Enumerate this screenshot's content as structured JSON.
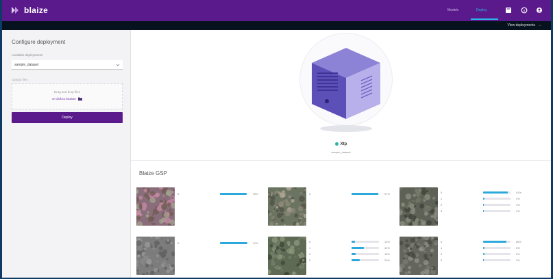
{
  "header": {
    "app_name": "blaize",
    "nav": [
      "Models",
      "Deploy"
    ],
    "active_nav": "Deploy",
    "icons": [
      "grid-icon",
      "info-icon",
      "account-icon"
    ],
    "brand_color": "#5a1a8c",
    "accent_color": "#29b6e8"
  },
  "subbar": {
    "view_deployments": "View deployments",
    "arrow": "→"
  },
  "sidebar": {
    "title": "Configure deployment",
    "select_label": "Available deployments",
    "select_value": "sample_dataset",
    "upload_label": "Upload files",
    "drop_text": "Drag and drop files",
    "drop_link": "or click to browse",
    "deploy_button": "Deploy"
  },
  "device": {
    "name": "Xtp",
    "subtitle": "sample_dataset",
    "status_color": "#28b4a0"
  },
  "results": {
    "section_title": "Blaize GSP",
    "items": [
      {
        "index": "0",
        "bars": [
          {
            "value": 0.98,
            "label": "98%"
          }
        ]
      },
      {
        "index": "0",
        "bars": [
          {
            "value": 0.97,
            "label": "97%"
          }
        ]
      },
      {
        "index": "0",
        "bars": [
          {
            "value": 0.91,
            "label": "91%"
          },
          {
            "value": 0.04,
            "label": "4%"
          },
          {
            "value": 0.03,
            "label": "3%"
          },
          {
            "value": 0.02,
            "label": "2%"
          }
        ]
      },
      {
        "index": "0",
        "bars": [
          {
            "value": 0.99,
            "label": "99%"
          }
        ]
      },
      {
        "index": "0",
        "bars": [
          {
            "value": 0.12,
            "label": "12%"
          },
          {
            "value": 0.44,
            "label": "44%"
          },
          {
            "value": 0.15,
            "label": "15%"
          },
          {
            "value": 0.29,
            "label": "29%"
          }
        ]
      },
      {
        "index": "0",
        "bars": [
          {
            "value": 0.86,
            "label": "86%"
          },
          {
            "value": 0.06,
            "label": "6%"
          },
          {
            "value": 0.05,
            "label": "5%"
          },
          {
            "value": 0.03,
            "label": "3%"
          }
        ]
      }
    ]
  }
}
